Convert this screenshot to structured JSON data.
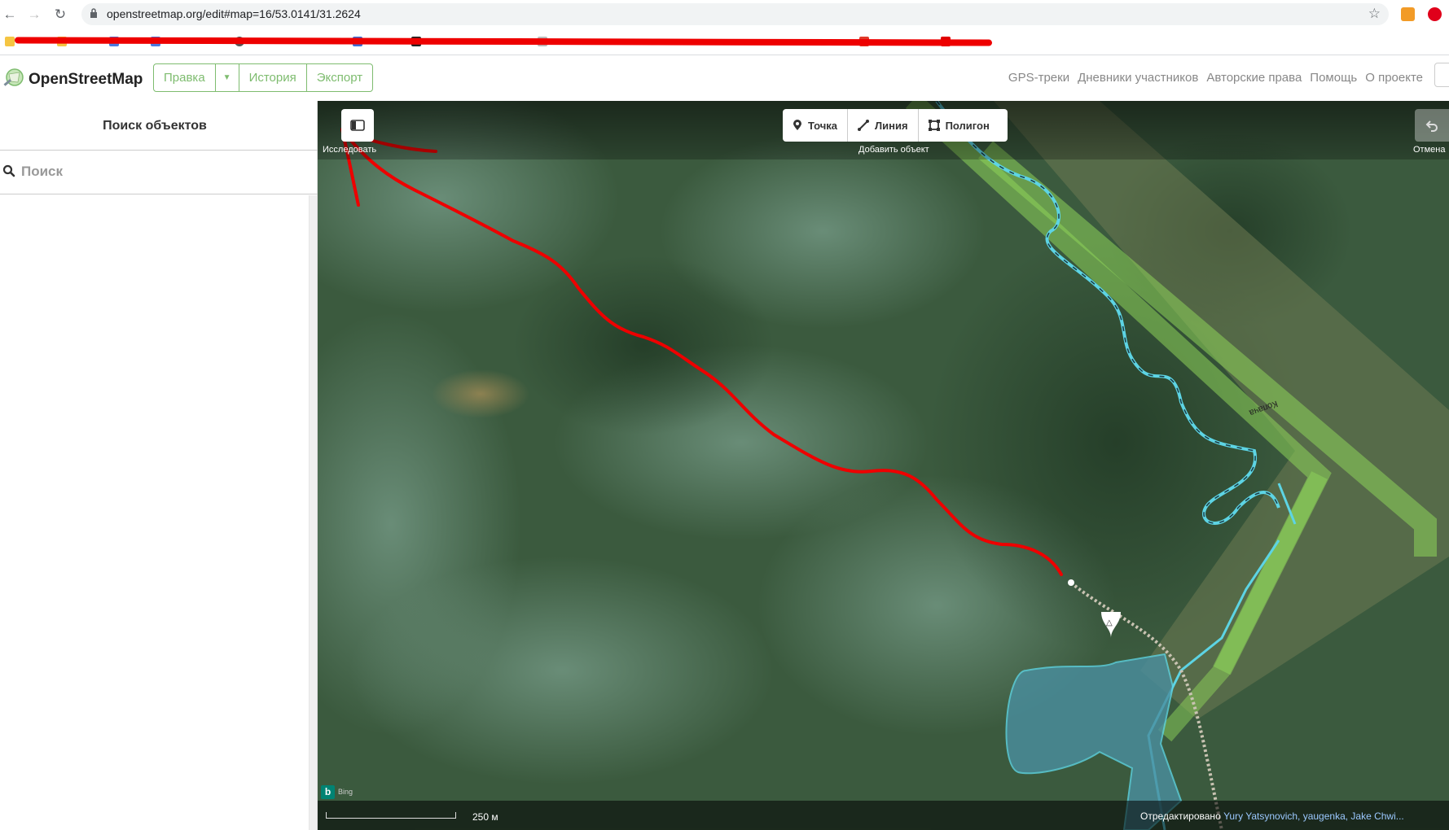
{
  "browser": {
    "url": "openstreetmap.org/edit#map=16/53.0141/31.2624"
  },
  "header": {
    "brand": "OpenStreetMap",
    "edit_label": "Правка",
    "history_label": "История",
    "export_label": "Экспорт",
    "nav": [
      "GPS-треки",
      "Дневники участников",
      "Авторские права",
      "Помощь",
      "О проекте"
    ]
  },
  "sidebar": {
    "title": "Поиск объектов",
    "search_placeholder": "Поиск"
  },
  "map": {
    "explore_label": "Исследовать",
    "add_point_label": "Точка",
    "add_line_label": "Линия",
    "add_area_label": "Полигон",
    "add_feature_label": "Добавить объект",
    "undo_label": "Отмена",
    "river_label": "Копача",
    "imagery_provider": "Bing",
    "scale_label": "250 м",
    "edited_by_label": "Отредактировано",
    "edited_by_users": "Yury Yatsynovich, yaugenka, Jake Chwi..."
  },
  "colors": {
    "osm_green": "#7ebc6f",
    "annotation_red": "#ee0000",
    "river_blue": "#5dd4e4"
  }
}
